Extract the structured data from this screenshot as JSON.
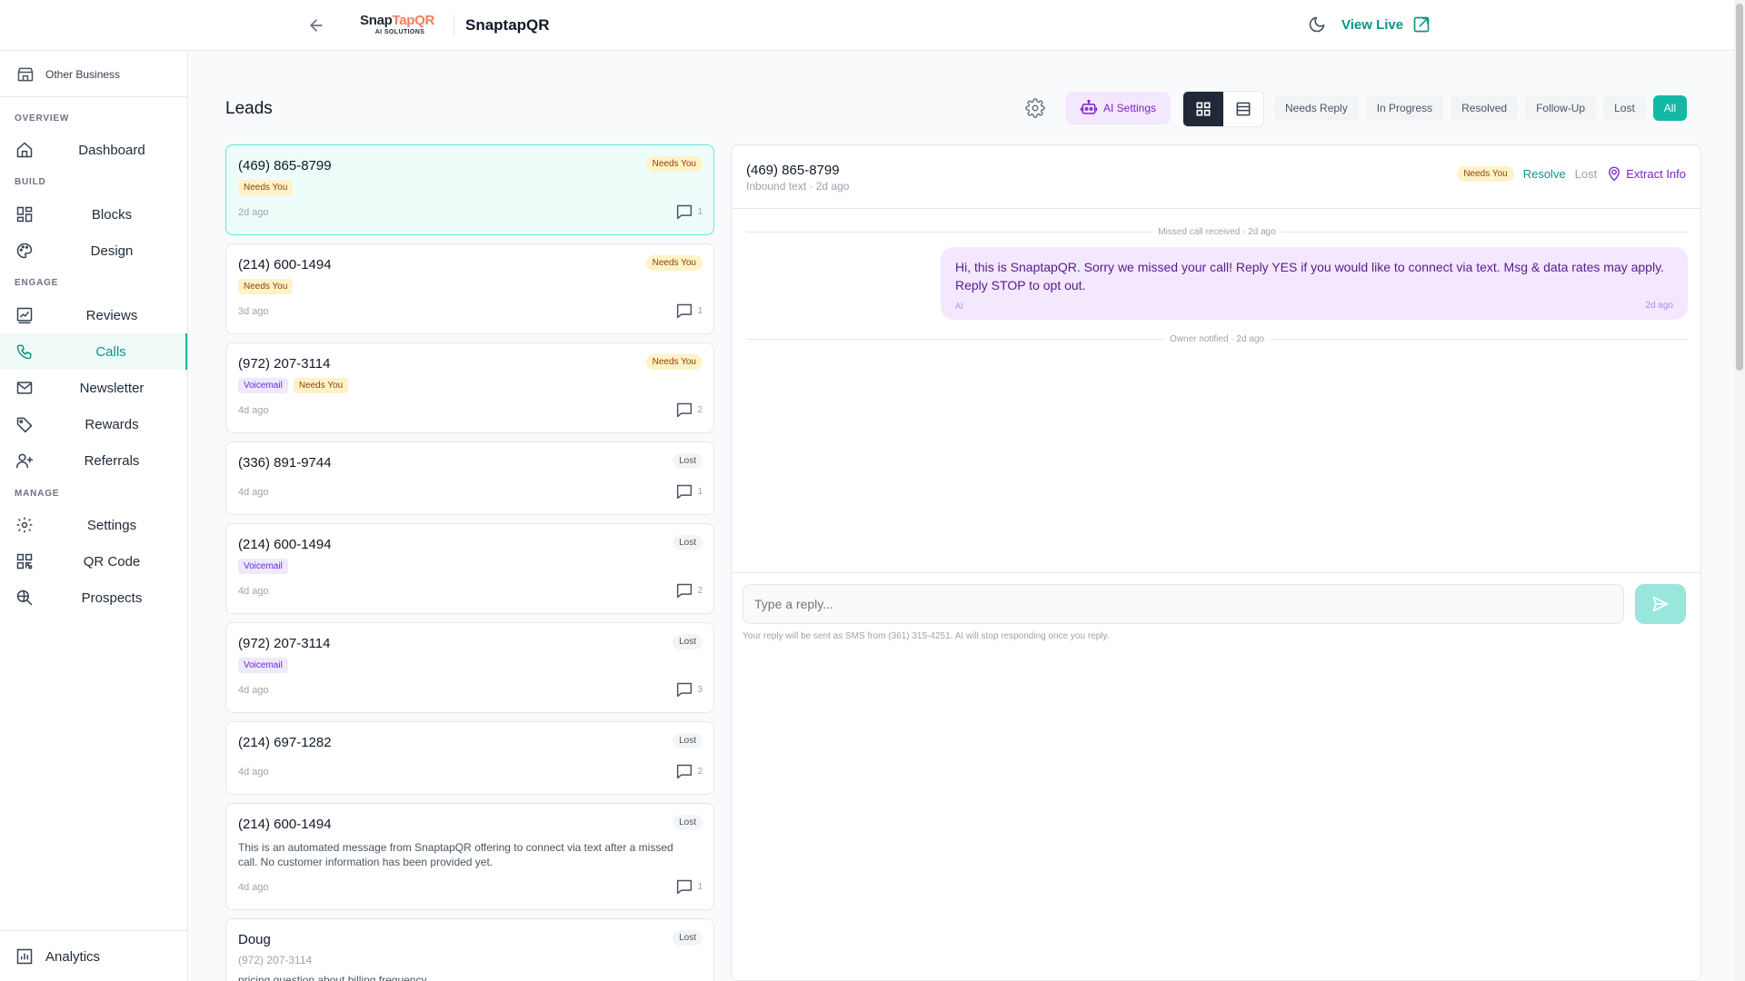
{
  "topbar": {
    "logo": {
      "snap": "Snap",
      "tap": "Tap",
      "qr": "QR",
      "sub": "AI SOLUTIONS"
    },
    "brand_name": "SnaptapQR",
    "view_live": "View Live"
  },
  "sidebar": {
    "business": "Other Business",
    "sections": {
      "overview": "OVERVIEW",
      "build": "BUILD",
      "engage": "ENGAGE",
      "manage": "MANAGE"
    },
    "items": {
      "dashboard": "Dashboard",
      "blocks": "Blocks",
      "design": "Design",
      "reviews": "Reviews",
      "calls": "Calls",
      "newsletter": "Newsletter",
      "rewards": "Rewards",
      "referrals": "Referrals",
      "settings": "Settings",
      "qrcode": "QR Code",
      "prospects": "Prospects"
    },
    "analytics": "Analytics"
  },
  "main": {
    "title": "Leads",
    "ai_settings": "AI Settings",
    "filters": [
      "Needs Reply",
      "In Progress",
      "Resolved",
      "Follow-Up",
      "Lost",
      "All"
    ],
    "active_filter": "All"
  },
  "leads": [
    {
      "phone": "(469) 865-8799",
      "status": "Needs You",
      "tags": [
        "Needs You"
      ],
      "time": "2d ago",
      "count": "1"
    },
    {
      "phone": "(214) 600-1494",
      "status": "Needs You",
      "tags": [
        "Needs You"
      ],
      "time": "3d ago",
      "count": "1"
    },
    {
      "phone": "(972) 207-3114",
      "status": "Needs You",
      "tags": [
        "Voicemail",
        "Needs You"
      ],
      "time": "4d ago",
      "count": "2"
    },
    {
      "phone": "(336) 891-9744",
      "status": "Lost",
      "tags": [],
      "time": "4d ago",
      "count": "1"
    },
    {
      "phone": "(214) 600-1494",
      "status": "Lost",
      "tags": [
        "Voicemail"
      ],
      "time": "4d ago",
      "count": "2"
    },
    {
      "phone": "(972) 207-3114",
      "status": "Lost",
      "tags": [
        "Voicemail"
      ],
      "time": "4d ago",
      "count": "3"
    },
    {
      "phone": "(214) 697-1282",
      "status": "Lost",
      "tags": [],
      "time": "4d ago",
      "count": "2"
    },
    {
      "phone": "(214) 600-1494",
      "status": "Lost",
      "description": "This is an automated message from SnaptapQR offering to connect via text after a missed call. No customer information has been provided yet.",
      "time": "4d ago",
      "count": "1"
    },
    {
      "phone": "Doug",
      "status": "Lost",
      "subphone": "(972) 207-3114",
      "preview": "pricing question about billing frequency"
    }
  ],
  "conversation": {
    "phone": "(469) 865-8799",
    "subtitle": "Inbound text · 2d ago",
    "badge": "Needs You",
    "resolve": "Resolve",
    "lost": "Lost",
    "extract": "Extract Info",
    "events": {
      "missed": "Missed call received · 2d ago",
      "notified": "Owner notified · 2d ago"
    },
    "message": {
      "text": "Hi, this is SnaptapQR. Sorry we missed your call! Reply YES if you would like to connect via text. Msg & data rates may apply. Reply STOP to opt out.",
      "author": "AI",
      "time": "2d ago"
    },
    "reply_placeholder": "Type a reply...",
    "reply_hint": "Your reply will be sent as SMS from (361) 315-4251. AI will stop responding once you reply."
  },
  "colors": {
    "accent": "#14b8a6",
    "accent_dark": "#0d9488",
    "purple": "#7e22ce",
    "needs_bg": "#fef3c7"
  }
}
